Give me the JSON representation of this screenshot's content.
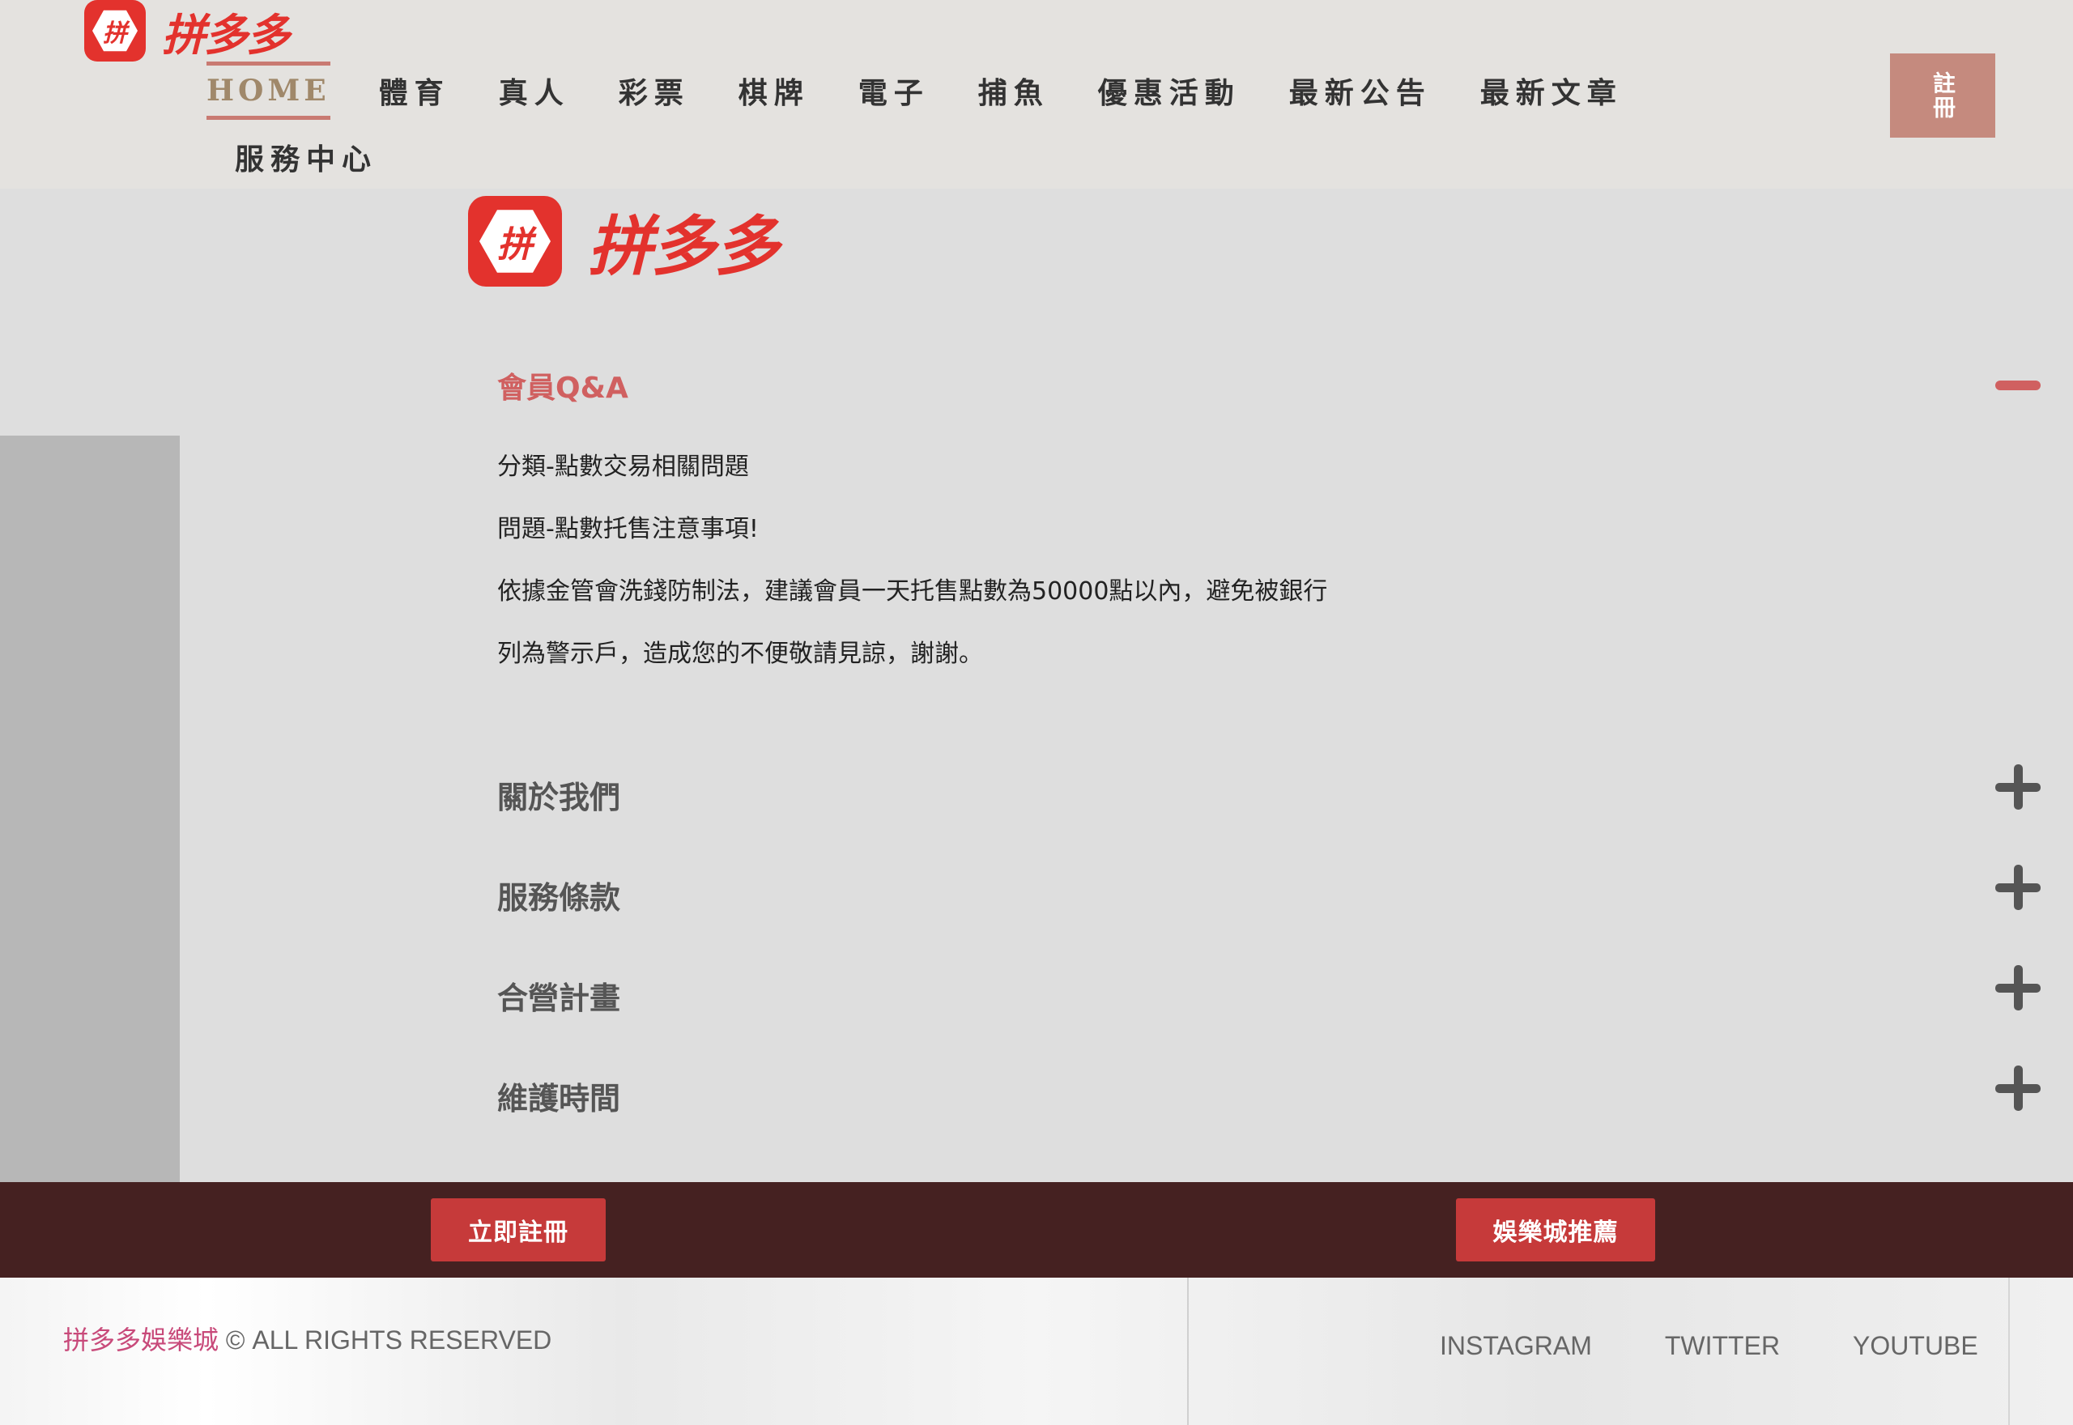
{
  "brand": {
    "name": "拼多多",
    "icon_glyph": "拼",
    "accent": "#e3322d"
  },
  "nav": {
    "row1": [
      "HOME",
      "體育",
      "真人",
      "彩票",
      "棋牌",
      "電子",
      "捕魚",
      "優惠活動",
      "最新公告",
      "最新文章"
    ],
    "row2": [
      "服務中心"
    ],
    "active": "HOME",
    "register_label": "註冊"
  },
  "faq": {
    "open": {
      "title": "會員Q&A",
      "lines": [
        "分類-點數交易相關問題",
        "問題-點數托售注意事項!",
        "依據金管會洗錢防制法，建議會員一天托售點數為50000點以內，避免被銀行",
        "列為警示戶，造成您的不便敬請見諒，謝謝。"
      ]
    },
    "items": [
      "關於我們",
      "服務條款",
      "合營計畫",
      "維護時間"
    ]
  },
  "cta": {
    "left": "立即註冊",
    "right": "娛樂城推薦"
  },
  "footer": {
    "site": "拼多多娛樂城",
    "rights": " © ALL RIGHTS RESERVED",
    "social": [
      "INSTAGRAM",
      "TWITTER",
      "YOUTUBE"
    ]
  },
  "colors": {
    "header_bg": "#e4e2df",
    "cta_bar": "#452121",
    "button": "#c63a3a",
    "faq_accent": "#d06060"
  }
}
